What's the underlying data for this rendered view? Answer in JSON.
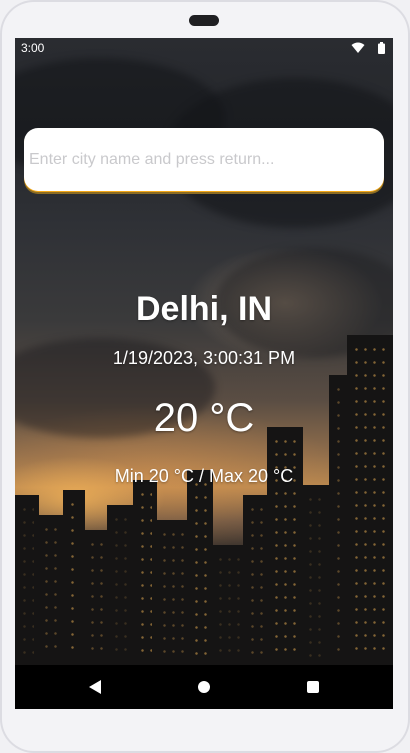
{
  "status_bar": {
    "time": "3:00"
  },
  "search": {
    "placeholder": "Enter city name and press return...",
    "value": ""
  },
  "weather": {
    "location": "Delhi, IN",
    "datetime": "1/19/2023, 3:00:31 PM",
    "temperature": "20 °C",
    "min_max": "Min 20 °C / Max 20 °C"
  },
  "colors": {
    "input_underline": "#f5a817",
    "text": "#ffffff",
    "nav_bar": "#000000"
  },
  "icons": {
    "wifi": "wifi-icon",
    "battery": "battery-icon",
    "back": "nav-back-icon",
    "home": "nav-home-icon",
    "recents": "nav-recents-icon"
  }
}
